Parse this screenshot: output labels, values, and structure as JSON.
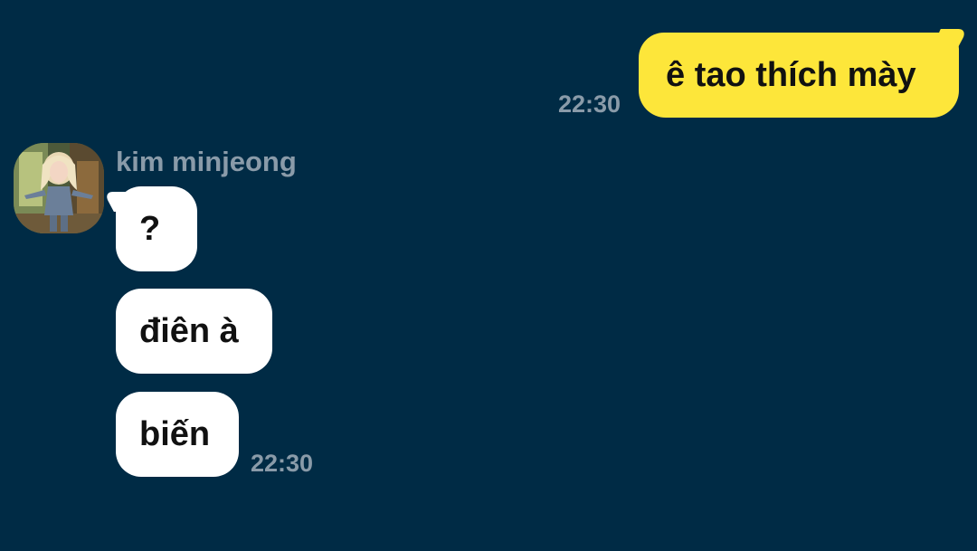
{
  "conversation": {
    "outgoing": {
      "text": "ê tao thích mày",
      "time": "22:30",
      "bubble_color": "#fde63a"
    },
    "incoming": {
      "sender": "kim minjeong",
      "avatar_icon": "profile-photo-avatar",
      "time": "22:30",
      "bubble_color": "#ffffff",
      "messages": [
        {
          "text": "?"
        },
        {
          "text": "điên à"
        },
        {
          "text": "biến"
        }
      ]
    }
  },
  "theme": {
    "background": "#002b45",
    "timestamp_color": "#8a9ba9"
  }
}
